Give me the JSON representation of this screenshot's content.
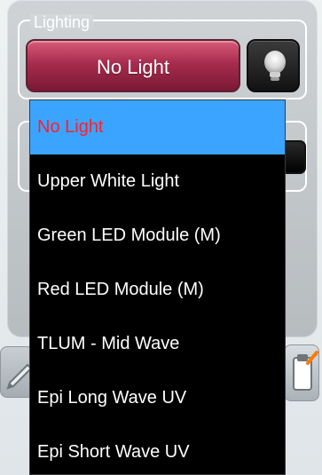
{
  "lighting": {
    "legend": "Lighting",
    "selected_label": "No Light",
    "dropdown_options": [
      "No Light",
      "Upper White Light",
      "Green LED Module (M)",
      "Red LED Module (M)",
      "TLUM - Mid Wave",
      "Epi Long Wave UV",
      "Epi Short Wave UV"
    ],
    "selected_index": 0
  },
  "icons": {
    "bulb_button": "lightbulb-icon",
    "left_partial": "pen-icon",
    "right_partial": "clipboard-icon"
  },
  "colors": {
    "accent_combo": "#a72c4d",
    "dropdown_bg": "#000000",
    "selected_bg": "#3ba4ff",
    "selected_text": "#ff1f2b"
  }
}
